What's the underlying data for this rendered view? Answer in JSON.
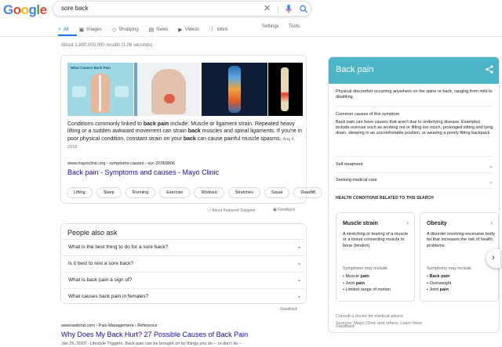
{
  "header": {
    "logo_letters": [
      "G",
      "o",
      "o",
      "g",
      "l",
      "e"
    ],
    "search_query": "sore back",
    "clear_icon": "close-icon",
    "mic_icon": "mic-icon",
    "search_icon": "search-icon"
  },
  "nav": {
    "tabs": [
      {
        "label": "All",
        "icon": "search-icon"
      },
      {
        "label": "Images",
        "icon": "image-icon"
      },
      {
        "label": "Shopping",
        "icon": "tag-icon"
      },
      {
        "label": "News",
        "icon": "news-icon"
      },
      {
        "label": "Videos",
        "icon": "video-icon"
      },
      {
        "label": "More",
        "icon": "dots-icon"
      }
    ],
    "settings": "Settings",
    "tools": "Tools"
  },
  "results_count": "About 1,800,000,000 results (1.06 seconds)",
  "featured": {
    "text_parts": [
      "Conditions commonly linked to ",
      "back pain",
      " include: Muscle or ligament strain. Repeated heavy lifting or a sudden awkward movement can strain ",
      "back",
      " muscles and spinal ligaments. If you're in poor physical condition, constant strain on your ",
      "back",
      " can cause painful muscle spasms."
    ],
    "date": "Aug 4, 2018",
    "cite": "www.mayoclinic.org › symptoms-causes › syc-20369906",
    "link": "Back pain - Symptoms and causes - Mayo Clinic",
    "image_caption": "What Causes Back Pain",
    "chips": [
      "Lifting",
      "Sleep",
      "Running",
      "Exercise",
      "Workout",
      "Stretches",
      "Squat",
      "Deadlift"
    ],
    "about_label": "About Featured Snippets",
    "feedback": "Feedback"
  },
  "paa": {
    "title": "People also ask",
    "questions": [
      "What is the best thing to do for a sore back?",
      "Is it best to rest a sore back?",
      "What is back pain a sign of?",
      "What causes back pain in females?"
    ],
    "feedback": "Feedback"
  },
  "result2": {
    "cite": "www.webmd.com › Pain Management › Reference",
    "link": "Why Does My Back Hurt? 27 Possible Causes of Back Pain",
    "snippet": "Jan 26, 2020 - Lifestyle Triggers. Back pain can be brought on by things you do -- or don't do --"
  },
  "knowledge_panel": {
    "title": "Back pain",
    "accent": "#4db6c6",
    "description": "Physical discomfort occurring anywhere on the spine or back, ranging from mild to disabling.",
    "causes_heading": "Common causes of this symptom",
    "causes_text": "Back pain can have causes that aren't due to underlying disease. Examples include overuse such as working out or lifting too much, prolonged sitting and lying down, sleeping in an uncomfortable position, or wearing a poorly fitting backpack.",
    "sections": [
      "Self-treatment",
      "Seeking medical care"
    ],
    "related_heading": "HEALTH CONDITIONS RELATED TO THIS SEARCH",
    "conditions": [
      {
        "name": "Muscle strain",
        "desc": "A stretching or tearing of a muscle or a tissue connecting muscle to bone (tendon).",
        "symptoms_label": "Symptoms may include",
        "symptoms": [
          [
            "Muscle ",
            "pain"
          ],
          [
            "Joint ",
            "pain"
          ],
          [
            "Limited range of motion",
            ""
          ]
        ]
      },
      {
        "name": "Obesity",
        "desc": "A disorder involving excessive body fat that increases the risk of health problems.",
        "symptoms_label": "Symptoms may include",
        "symptoms": [
          [
            "",
            "Back pain"
          ],
          [
            "Overweight",
            ""
          ],
          [
            "Joint ",
            "pain"
          ]
        ]
      }
    ],
    "consult": "Consult a doctor for medical advice",
    "sources": "Sources: Mayo Clinic and others. Learn more",
    "feedback": "Feedback"
  }
}
